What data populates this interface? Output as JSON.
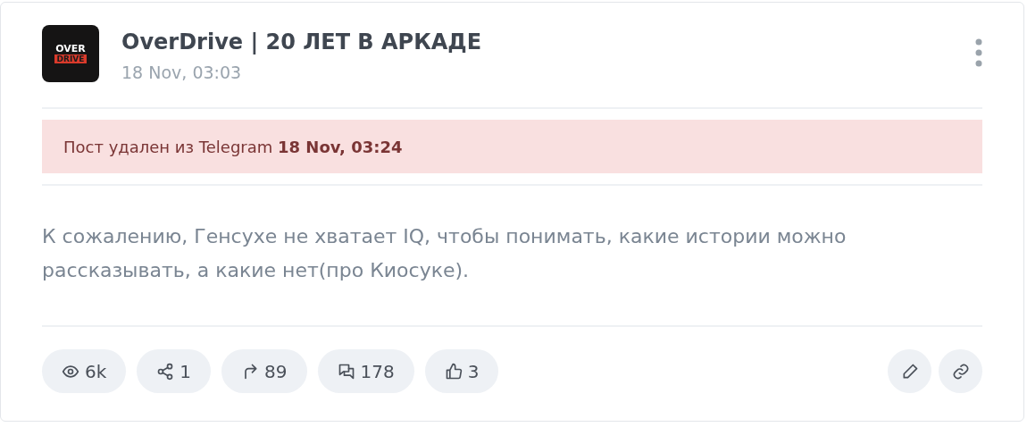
{
  "channel": {
    "avatar": {
      "lines": [
        "OVER",
        "DRIVE"
      ]
    },
    "name": "OverDrive | 20 ЛЕТ В АРКАДЕ",
    "date": "18 Nov, 03:03"
  },
  "notice": {
    "text": "Пост удален из Telegram **18 Nov, 03:24**"
  },
  "post": {
    "text": "К сожалению, Генсухе не хватает IQ, чтобы понимать, какие истории можно рассказывать, а какие нет(про Киосуке)."
  },
  "stats": [
    {
      "kind": "views",
      "value": "6k"
    },
    {
      "kind": "shares",
      "value": "1"
    },
    {
      "kind": "forwards",
      "value": "89"
    },
    {
      "kind": "comments",
      "value": "178"
    },
    {
      "kind": "likes",
      "value": "3"
    }
  ],
  "actions": [
    {
      "kind": "edit"
    },
    {
      "kind": "link"
    }
  ]
}
